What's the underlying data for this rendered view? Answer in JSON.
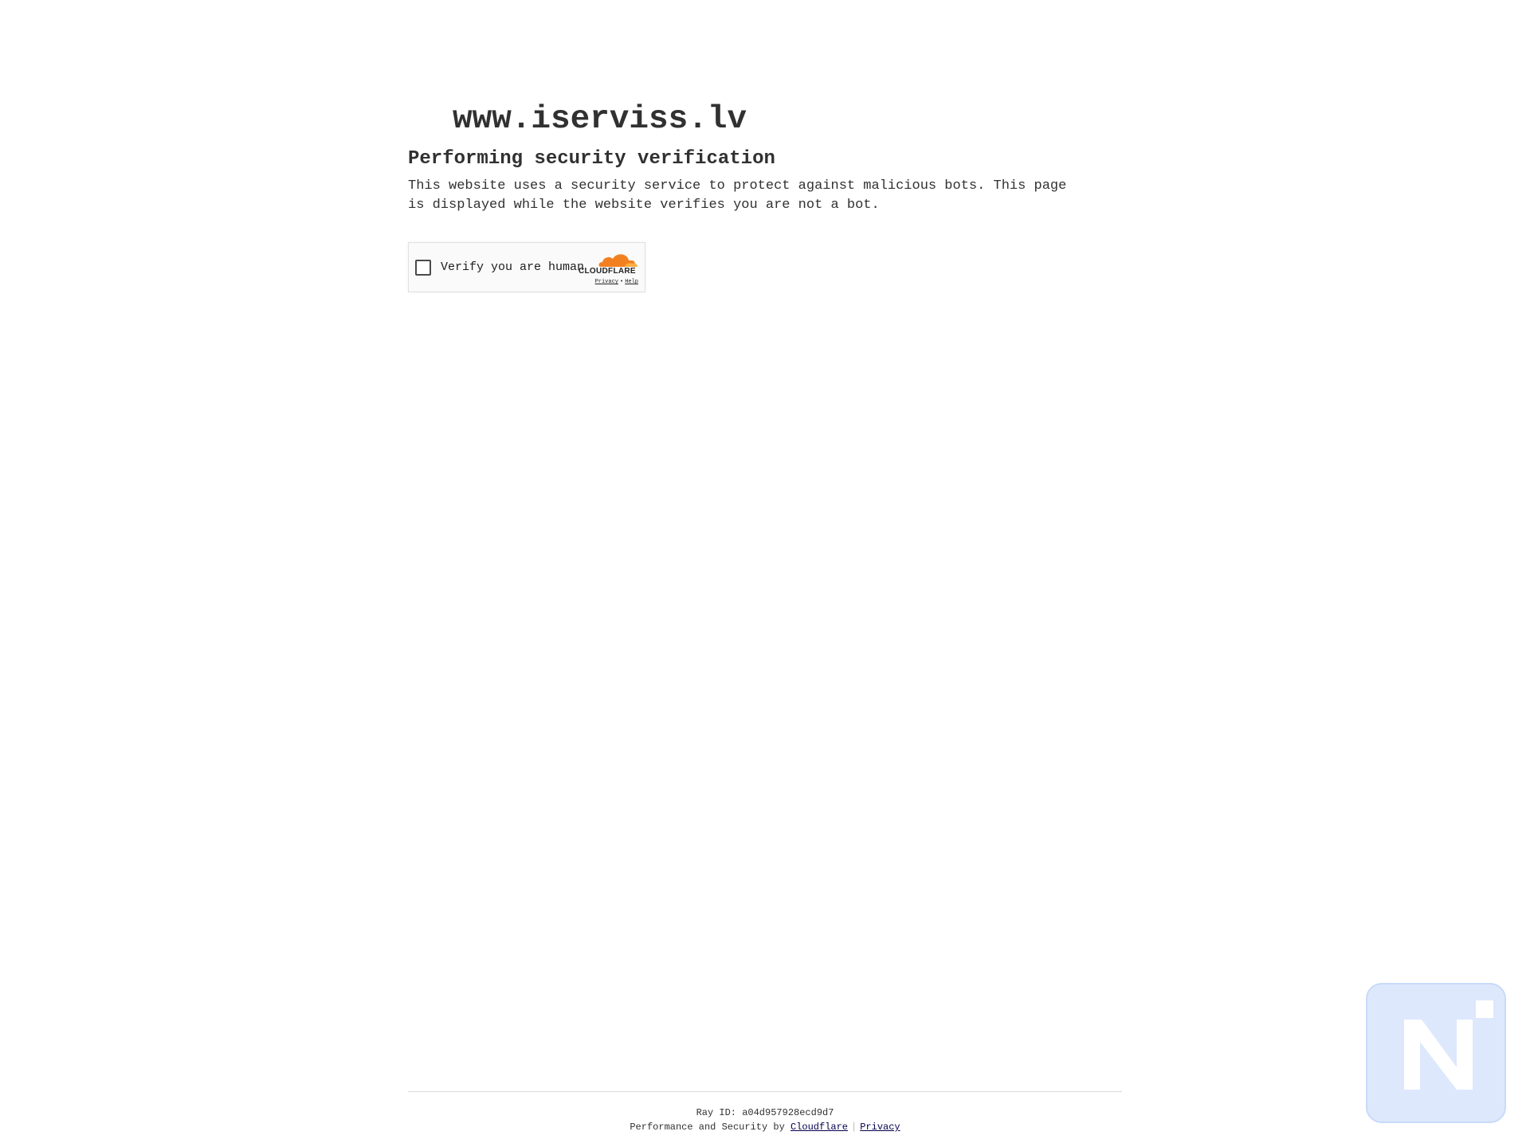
{
  "page": {
    "site_title": "www.iserviss.lv",
    "heading": "Performing security verification",
    "description": "This website uses a security service to protect against malicious bots. This page is displayed while the website verifies you are not a bot."
  },
  "turnstile": {
    "label": "Verify you are human",
    "brand": "CLOUDFLARE",
    "privacy_link": "Privacy",
    "separator": "•",
    "help_link": "Help",
    "brand_color": "#f38020",
    "checked": false
  },
  "footer": {
    "ray_label": "Ray ID:",
    "ray_id": "a04d957928ecd9d7",
    "perf_text": "Performance and Security by",
    "cloudflare_link": "Cloudflare",
    "separator": "|",
    "privacy_link": "Privacy",
    "link_color": "#06004d"
  },
  "overlay": {
    "badge_icon": "n-logo-icon",
    "badge_color": "#dde8fc"
  }
}
